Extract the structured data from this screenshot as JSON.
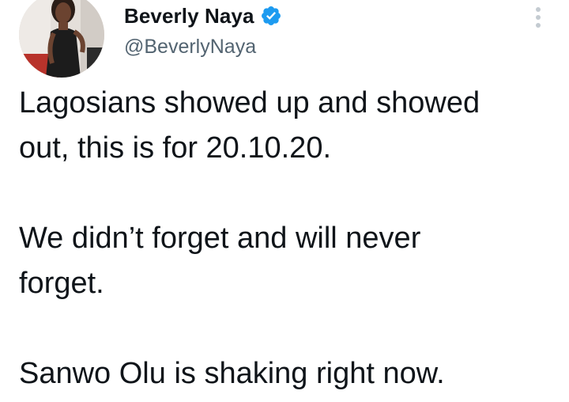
{
  "author": {
    "display_name": "Beverly Naya",
    "handle": "@BeverlyNaya",
    "verified": true,
    "avatar_icon": "profile-photo"
  },
  "tweet": {
    "paragraphs": [
      "Lagosians showed up and showed\nout, this is for 20.10.20.",
      "We didn’t forget and will never\nforget.",
      "Sanwo Olu is shaking right now."
    ]
  },
  "menu_icon": "more-vertical-icon",
  "colors": {
    "text": "#0f1419",
    "secondary": "#536471",
    "verified_blue": "#1d9bf0",
    "menu_dots": "#c4cbd1"
  }
}
